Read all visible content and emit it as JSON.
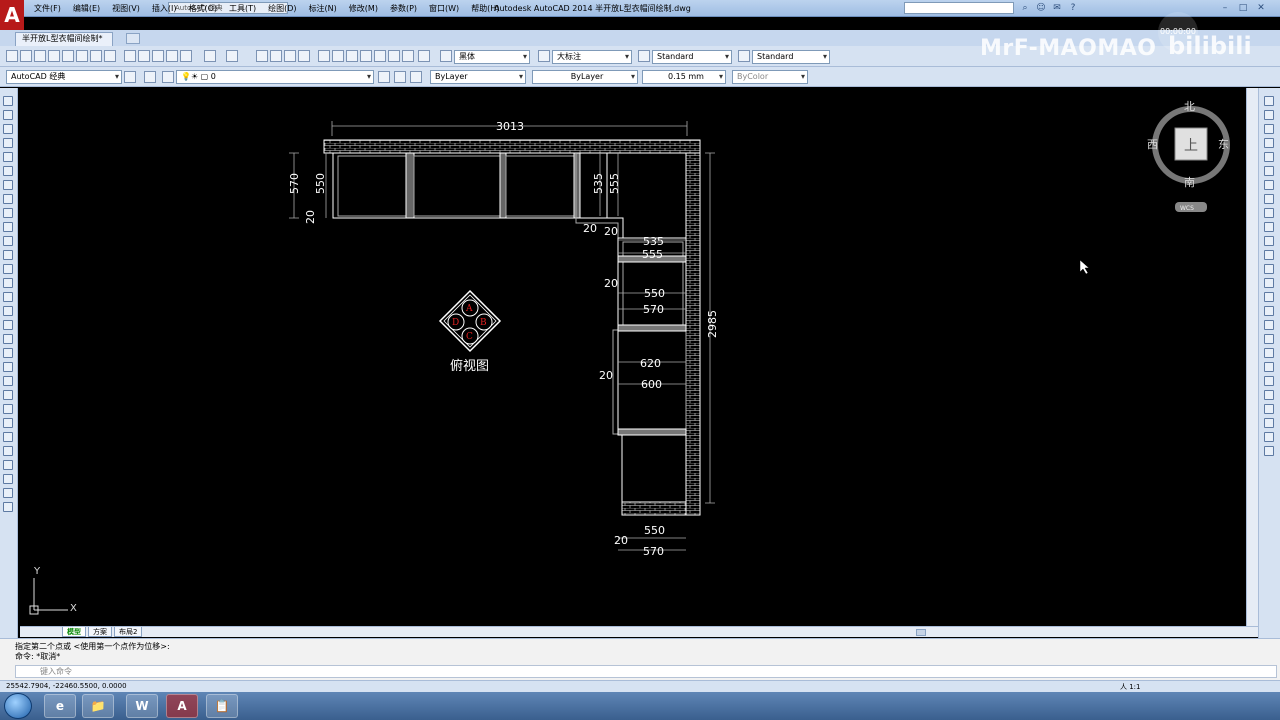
{
  "app": {
    "title": "Autodesk AutoCAD 2014    半开放L型衣帽间绘制.dwg",
    "quick_access": "AutoCAD 经典",
    "menu": [
      "文件(F)",
      "编辑(E)",
      "视图(V)",
      "插入(I)",
      "格式(O)",
      "工具(T)",
      "绘图(D)",
      "标注(N)",
      "修改(M)",
      "参数(P)",
      "窗口(W)",
      "帮助(H)"
    ],
    "file_tab": "半开放L型衣帽间绘制*"
  },
  "toolbar": {
    "workspace": "AutoCAD 经典",
    "layer": "0",
    "font": "黑体",
    "dim_style_font": "大标注",
    "text_style": "Standard",
    "table_style": "Standard",
    "color": "ByLayer",
    "linetype": "ByLayer",
    "lineweight": "0.15 mm",
    "plot_style": "ByColor"
  },
  "viewcube": {
    "north": "北",
    "south": "南",
    "east": "东",
    "west": "西",
    "top": "上",
    "wcs": "WCS"
  },
  "drawing": {
    "dims": {
      "top_width": "3013",
      "right_height": "2985",
      "left_570": "570",
      "left_550": "550",
      "left_20": "20",
      "mid_535": "535",
      "mid_555": "555",
      "corner_20": "20",
      "corner_20b": "20",
      "r1_535": "535",
      "r1_555": "555",
      "r2_20": "20",
      "r2_550": "550",
      "r2_570": "570",
      "r3_620": "620",
      "r3_20": "20",
      "r3_600": "600",
      "bottom_550": "550",
      "bottom_20": "20",
      "bottom_570": "570"
    },
    "compass": {
      "a": "A",
      "b": "B",
      "c": "C",
      "d": "D"
    },
    "view_label": "俯视图",
    "ucs_y": "Y",
    "ucs_x": "X"
  },
  "layout_tabs": [
    "模型",
    "方案",
    "布局2"
  ],
  "command": {
    "line1": "指定第二个点或 <使用第一个点作为位移>:",
    "line2": "命令: *取消*",
    "placeholder": "键入命令"
  },
  "status": {
    "coords": "25542.7904, -22460.5500, 0.0000",
    "scale": "人 1:1"
  },
  "overlay": {
    "watermark": "MrF-MAOMAO",
    "bili": "bilibili",
    "timer": "00:00:00"
  },
  "taskbar": {
    "apps": [
      "e",
      "📁",
      "W",
      "A",
      "📋"
    ]
  }
}
